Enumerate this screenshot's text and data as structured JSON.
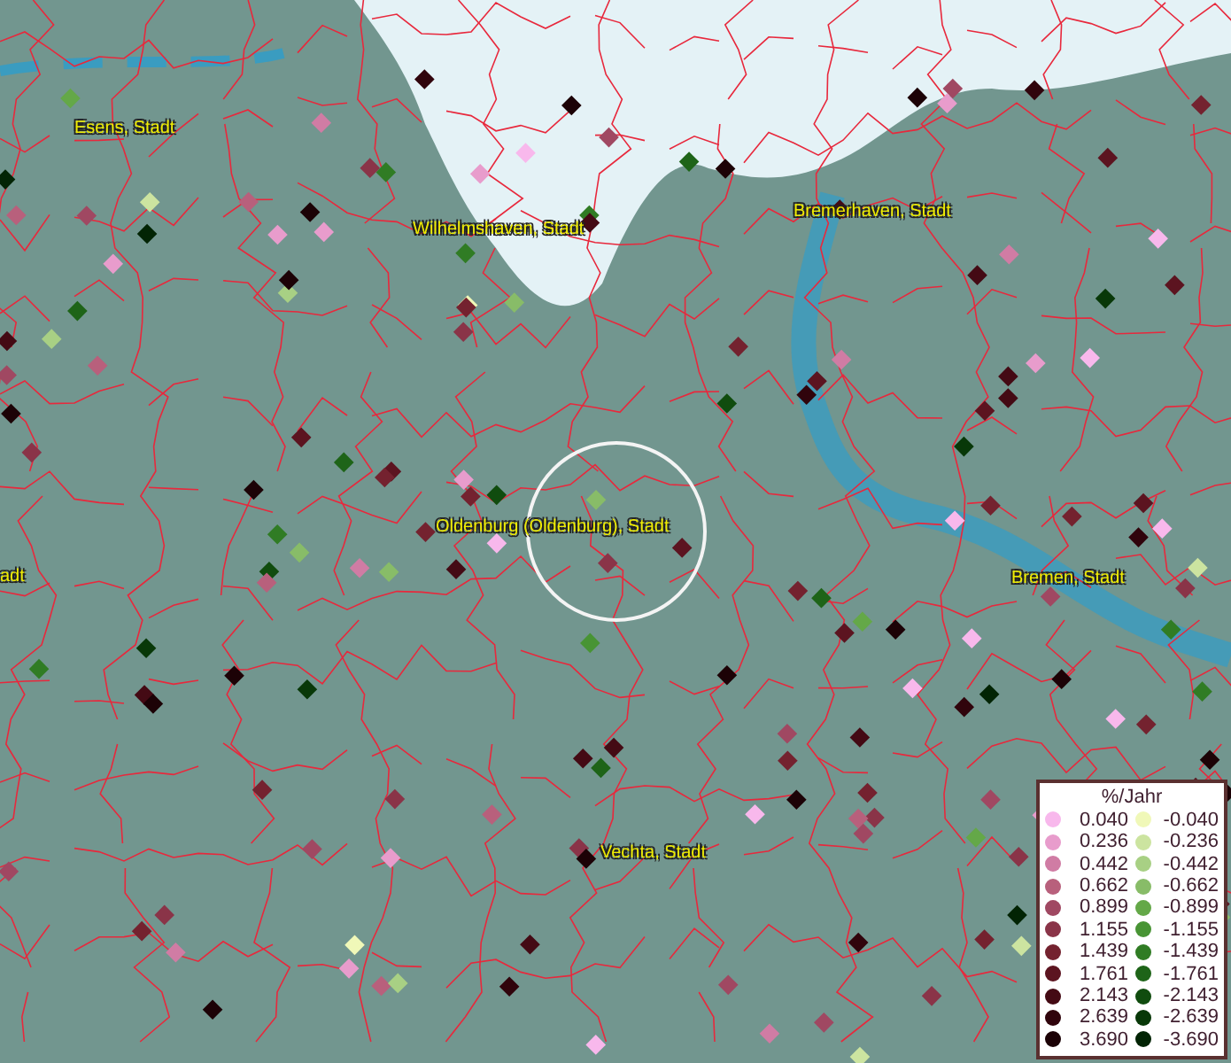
{
  "map": {
    "place_labels": [
      "Esens, Stadt",
      "Wilhelmshaven, Stadt",
      "Bremerhaven, Stadt",
      "Oldenburg (Oldenburg), Stadt",
      "adt",
      "Bremen, Stadt",
      "Vechta, Stadt"
    ]
  },
  "legend": {
    "title": "%/Jahr",
    "positive": [
      {
        "label": "0.040",
        "color": "#f8b8ec"
      },
      {
        "label": "0.236",
        "color": "#e89ccc"
      },
      {
        "label": "0.442",
        "color": "#d07ca4"
      },
      {
        "label": "0.662",
        "color": "#b8607c"
      },
      {
        "label": "0.899",
        "color": "#a04862"
      },
      {
        "label": "1.155",
        "color": "#8a3448"
      },
      {
        "label": "1.439",
        "color": "#74222f"
      },
      {
        "label": "1.761",
        "color": "#5c1420"
      },
      {
        "label": "2.143",
        "color": "#440a14"
      },
      {
        "label": "2.639",
        "color": "#30040c"
      },
      {
        "label": "3.690",
        "color": "#1c0206"
      }
    ],
    "negative": [
      {
        "label": "-0.040",
        "color": "#f0f8b8"
      },
      {
        "label": "-0.236",
        "color": "#cce4a0"
      },
      {
        "label": "-0.442",
        "color": "#a8d084"
      },
      {
        "label": "-0.662",
        "color": "#88bc68"
      },
      {
        "label": "-0.899",
        "color": "#64a848"
      },
      {
        "label": "-1.155",
        "color": "#489434"
      },
      {
        "label": "-1.439",
        "color": "#307c24"
      },
      {
        "label": "-1.761",
        "color": "#1e6418"
      },
      {
        "label": "-2.143",
        "color": "#104c0e"
      },
      {
        "label": "-2.639",
        "color": "#083808"
      },
      {
        "label": "-3.690",
        "color": "#022404"
      }
    ]
  }
}
